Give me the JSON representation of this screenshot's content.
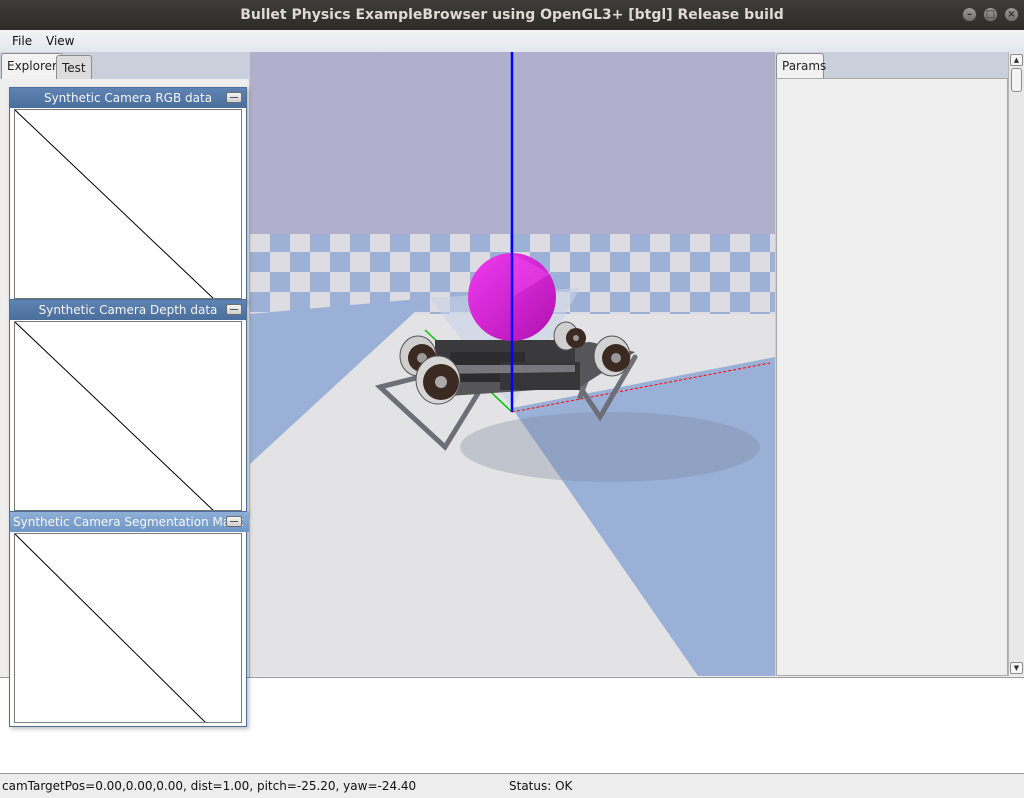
{
  "window": {
    "title": "Bullet Physics ExampleBrowser using OpenGL3+ [btgl] Release build",
    "buttons": [
      {
        "name": "minimize-button",
        "glyph": "–"
      },
      {
        "name": "maximize-button",
        "glyph": "□"
      },
      {
        "name": "close-button",
        "glyph": "×"
      }
    ]
  },
  "menubar": {
    "file": "File",
    "view": "View"
  },
  "left_tabs": {
    "explorer": "Explorer",
    "test": "Test"
  },
  "camera_windows": [
    {
      "title": "Synthetic Camera RGB data"
    },
    {
      "title": "Synthetic Camera Depth data"
    },
    {
      "title": "Synthetic Camera Segmentation Mask"
    }
  ],
  "viewport": {
    "colors": {
      "sky": "#b0b0cc",
      "ground_light": "#e4e4e6",
      "ground_blue": "#9ab0d6",
      "sphere": "#e21ee2",
      "z_axis": "#0000ff",
      "x_axis": "#ff0000",
      "y_axis": "#00c800"
    }
  },
  "right_tabs": {
    "params": "Params"
  },
  "status": {
    "camera": "camTargetPos=0.00,0.00,0.00, dist=1.00, pitch=-25.20, yaw=-24.40",
    "state": "Status: OK"
  }
}
